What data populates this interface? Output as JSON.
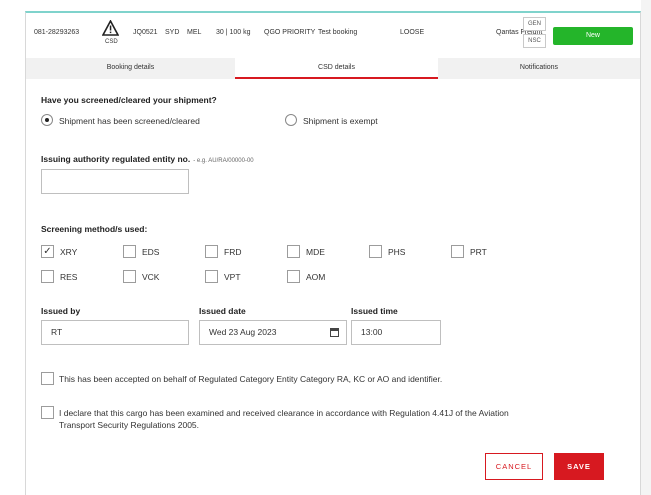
{
  "header": {
    "awb": "081-28293263",
    "csd_label": "CSD",
    "flight": "JQ0521",
    "origin": "SYD",
    "destination": "MEL",
    "weight": "30 | 100 kg",
    "service": "QGO PRIORITY",
    "booking_note": "Test booking",
    "packaging": "LOOSE",
    "carrier": "Qantas Freight",
    "tag_gen": "GEN",
    "tag_nsc": "NSC",
    "status_button": "New",
    "warning_icon": "warning-triangle-icon"
  },
  "tabs": [
    {
      "label": "Booking details",
      "active": false
    },
    {
      "label": "CSD details",
      "active": true
    },
    {
      "label": "Notifications",
      "active": false
    }
  ],
  "screening": {
    "question": "Have you screened/cleared your shipment?",
    "option_screened": "Shipment has been screened/cleared",
    "option_exempt": "Shipment is exempt",
    "selected": "screened"
  },
  "authority": {
    "label": "Issuing authority regulated entity no.",
    "hint": "- e.g. AU/RA/00000-00",
    "value": ""
  },
  "methods": {
    "label": "Screening method/s used:",
    "items": [
      {
        "code": "XRY",
        "checked": true
      },
      {
        "code": "EDS",
        "checked": false
      },
      {
        "code": "FRD",
        "checked": false
      },
      {
        "code": "MDE",
        "checked": false
      },
      {
        "code": "PHS",
        "checked": false
      },
      {
        "code": "PRT",
        "checked": false
      },
      {
        "code": "RES",
        "checked": false
      },
      {
        "code": "VCK",
        "checked": false
      },
      {
        "code": "VPT",
        "checked": false
      },
      {
        "code": "AOM",
        "checked": false
      }
    ]
  },
  "issued": {
    "by_label": "Issued by",
    "by_value": "RT",
    "date_label": "Issued date",
    "date_value": "Wed 23 Aug 2023",
    "time_label": "Issued time",
    "time_value": "13:00",
    "calendar_icon": "calendar-icon"
  },
  "declarations": {
    "accepted": "This has been accepted on behalf of Regulated Category Entity Category RA, KC or AO and identifier.",
    "declare_line1": "I declare that this cargo has been examined and received clearance in accordance with Regulation 4.41J of the Aviation",
    "declare_line2": "Transport Security Regulations 2005."
  },
  "actions": {
    "cancel": "CANCEL",
    "save": "SAVE"
  },
  "colors": {
    "accent_red": "#d71920",
    "status_green": "#24b52a",
    "frame_top": "#7fd3cc"
  }
}
